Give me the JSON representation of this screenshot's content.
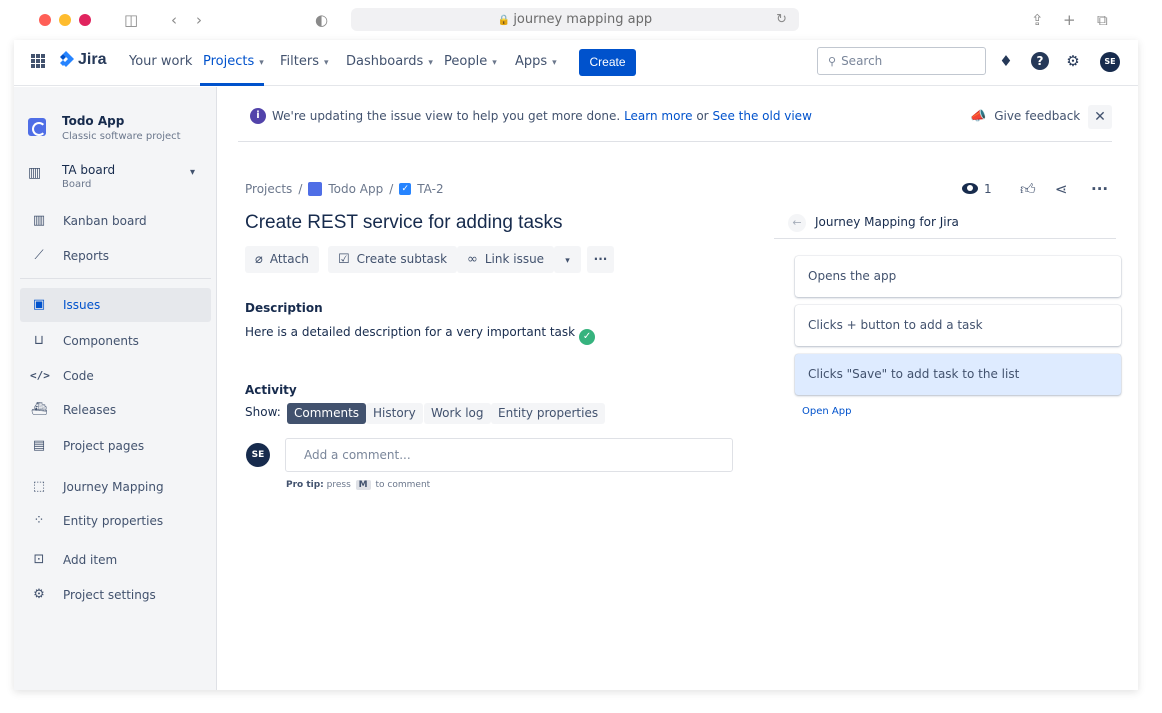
{
  "browser": {
    "address": "journey mapping app",
    "lock_icon": "🔒"
  },
  "topnav": {
    "logo_text": "Jira",
    "items": [
      {
        "label": "Your work"
      },
      {
        "label": "Projects"
      },
      {
        "label": "Filters"
      },
      {
        "label": "Dashboards"
      },
      {
        "label": "People"
      },
      {
        "label": "Apps"
      }
    ],
    "create_label": "Create",
    "search_placeholder": "Search",
    "avatar_initials": "SE"
  },
  "sidebar": {
    "project_name": "Todo App",
    "project_type": "Classic software project",
    "board_name": "TA board",
    "board_sub": "Board",
    "items": [
      {
        "label": "Kanban board"
      },
      {
        "label": "Reports"
      },
      {
        "label": "Issues"
      },
      {
        "label": "Components"
      },
      {
        "label": "Code"
      },
      {
        "label": "Releases"
      },
      {
        "label": "Project pages"
      },
      {
        "label": "Journey Mapping"
      },
      {
        "label": "Entity properties"
      },
      {
        "label": "Add item"
      },
      {
        "label": "Project settings"
      }
    ]
  },
  "banner": {
    "message": "We're updating the issue view to help you get more done.",
    "learn_more": "Learn more",
    "or": "or",
    "old_view": "See the old view",
    "feedback": "Give feedback"
  },
  "issue": {
    "breadcrumb": {
      "projects": "Projects",
      "project": "Todo App",
      "key": "TA-2"
    },
    "title": "Create REST service for adding tasks",
    "actions": {
      "attach": "Attach",
      "create_subtask": "Create subtask",
      "link_issue": "Link issue"
    },
    "watchers": "1",
    "description_heading": "Description",
    "description_text": "Here is a detailed description for a very important task",
    "activity_heading": "Activity",
    "show_label": "Show:",
    "tabs": [
      "Comments",
      "History",
      "Work log",
      "Entity properties"
    ],
    "comment_placeholder": "Add a comment...",
    "commenter_initials": "SE",
    "pro_tip_label": "Pro tip:",
    "pro_tip_press": "press",
    "pro_tip_key": "M",
    "pro_tip_suffix": "to comment"
  },
  "journey": {
    "title": "Journey Mapping for Jira",
    "steps": [
      "Opens the app",
      "Clicks + button to add a task",
      "Clicks \"Save\" to add task to the list"
    ],
    "open_app": "Open App"
  },
  "colors": {
    "brand": "#0052cc",
    "active_step": "#deebff",
    "success": "#36b37e"
  }
}
